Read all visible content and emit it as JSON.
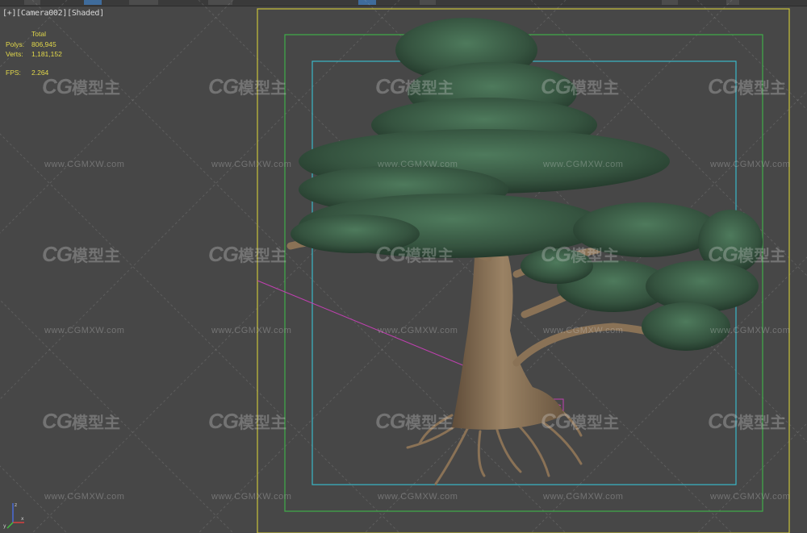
{
  "viewport": {
    "label_parts": [
      "[+]",
      "[Camera002]",
      "[Shaded]"
    ],
    "stats": {
      "total_label": "Total",
      "polys_label": "Polys:",
      "polys_value": "806,945",
      "verts_label": "Verts:",
      "verts_value": "1,181,152",
      "fps_label": "FPS:",
      "fps_value": "2.264"
    },
    "colors": {
      "background": "#474747",
      "safe_frame_outer": "#c9c23a",
      "safe_frame_action": "#3fae4a",
      "safe_frame_title": "#3ab8c8",
      "camera_line": "#c040b0",
      "stats_text": "#e2d84a",
      "foliage": "#3d5f4a",
      "trunk": "#8a7256"
    },
    "axis_gizmo": {
      "x": "x",
      "y": "y",
      "z": "z"
    }
  },
  "watermark": {
    "logo_latin": "CG",
    "logo_chinese": "模型主",
    "url": "www.CGMXW.com"
  }
}
